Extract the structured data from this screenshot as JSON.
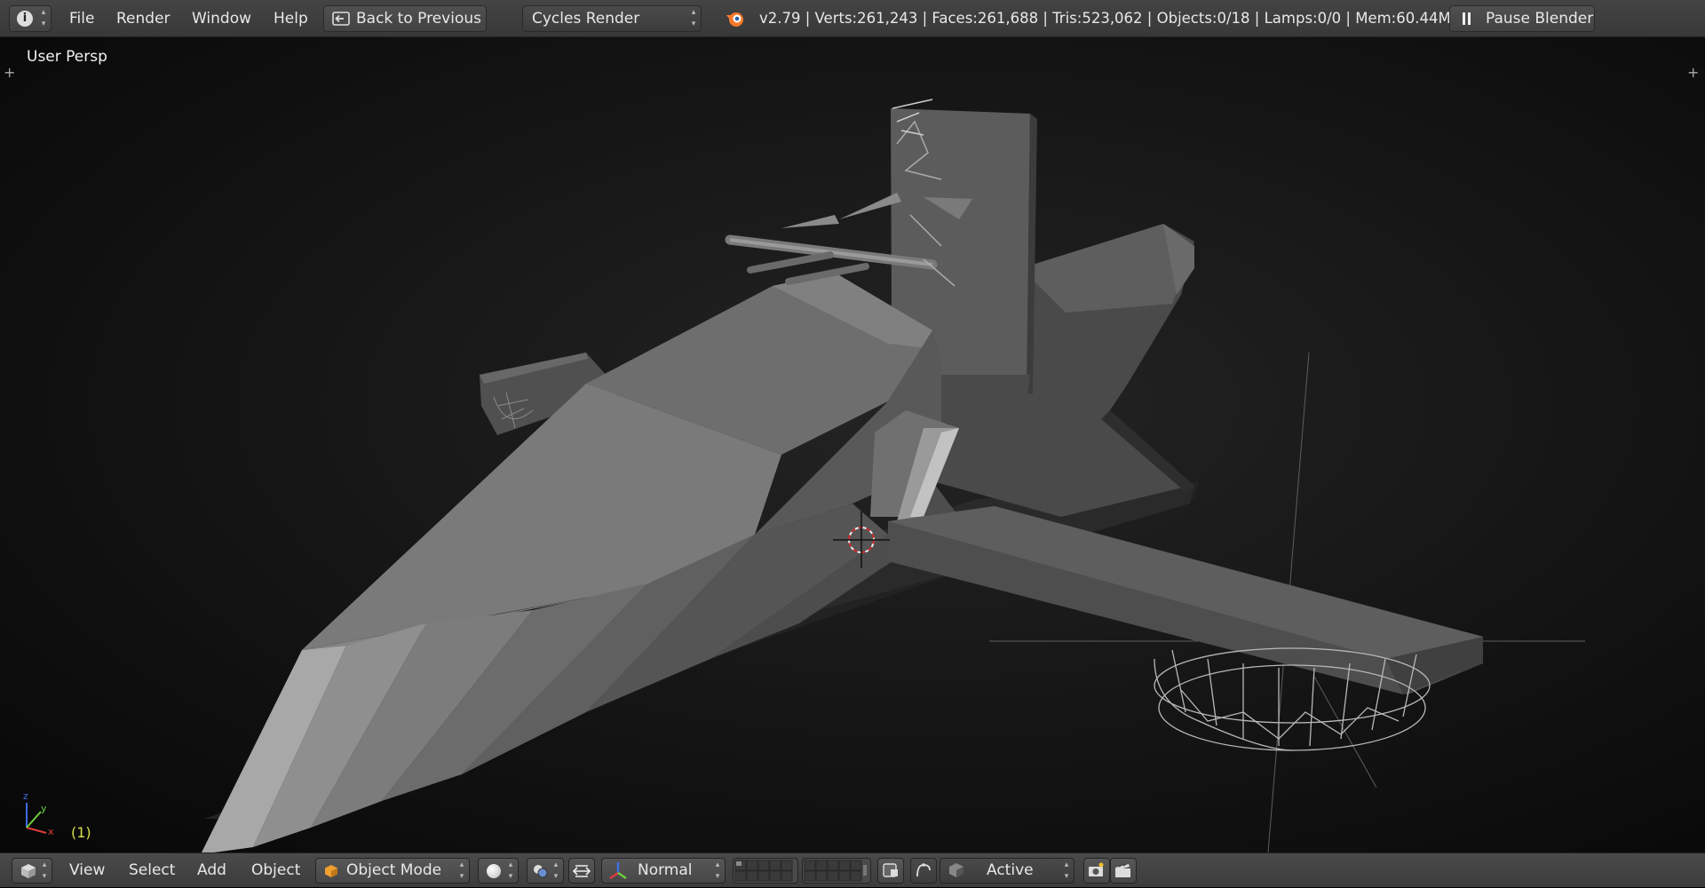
{
  "topbar": {
    "menu": [
      "File",
      "Render",
      "Window",
      "Help"
    ],
    "back_button": "Back to Previous",
    "render_engine": "Cycles Render",
    "stats": "v2.79 | Verts:261,243 | Faces:261,688 | Tris:523,062 | Objects:0/18 | Lamps:0/0 | Mem:60.44M",
    "pause_button": "Pause Blender"
  },
  "viewport": {
    "label": "User Persp",
    "frame": "(1)",
    "axis_labels": {
      "x": "x",
      "y": "y",
      "z": "z"
    }
  },
  "bottombar": {
    "menu": [
      "View",
      "Select",
      "Add",
      "Object"
    ],
    "mode": "Object Mode",
    "transform_orientation": "Normal",
    "pivot_active": "Active"
  },
  "colors": {
    "header_bg": "#3f3f3f",
    "viewport_bg": "#141414",
    "frame_text": "#d8e04a",
    "cursor_red": "#d22a2a",
    "axis_x": "#e03c3c",
    "axis_y": "#6ccf3c",
    "axis_z": "#3c6fe0"
  },
  "icons": [
    "info-icon",
    "back-icon",
    "blender-logo-icon",
    "pause-icon",
    "cube-view-icon",
    "object-mode-cube-icon",
    "viewport-shading-sphere-icon",
    "pivot-icon",
    "manipulator-icon",
    "transform-orientation-icon",
    "layers-icon",
    "lock-layers-icon",
    "proportional-edit-icon",
    "snap-icon",
    "render-camera-icon",
    "render-clip-icon"
  ]
}
